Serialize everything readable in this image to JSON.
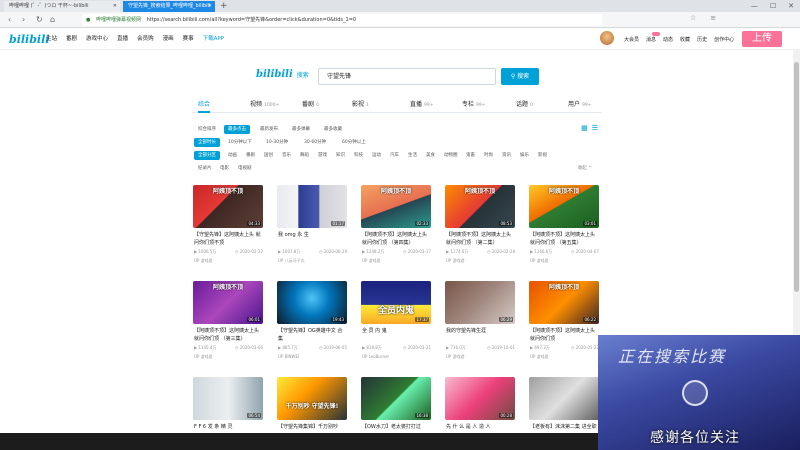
{
  "browser": {
    "tabs": [
      {
        "title": "哔哩哔哩 (゜-゜)つロ 干杯~-bilibili"
      },
      {
        "title": "守望先锋_搜索结果_哔哩哔哩_bilibili"
      }
    ],
    "new_tab": "+",
    "window_controls": [
      "—",
      "☐",
      "✕"
    ],
    "nav": {
      "back": "‹",
      "forward": "›",
      "reload": "↻",
      "home": "⌂"
    },
    "url_site": "哔哩哔哩弹幕视频网",
    "url": "https://search.bilibili.com/all?keyword=守望先锋&order=click&duration=0&tids_1=0"
  },
  "header": {
    "logo": "bilibili",
    "nav": [
      "主站",
      "番剧",
      "游戏中心",
      "直播",
      "会员购",
      "漫画",
      "赛事"
    ],
    "app": "下载APP",
    "right": [
      "大会员",
      "消息",
      "动态",
      "收藏",
      "历史",
      "创作中心"
    ],
    "upload": "上传"
  },
  "search": {
    "logo": "bilibili",
    "logo_sub": "搜索",
    "query": "守望先锋",
    "button": "搜索"
  },
  "category_tabs": [
    {
      "label": "综合",
      "count": ""
    },
    {
      "label": "视频",
      "count": "1000+"
    },
    {
      "label": "番剧",
      "count": "0"
    },
    {
      "label": "影视",
      "count": "1"
    },
    {
      "label": "直播",
      "count": "99+"
    },
    {
      "label": "专栏",
      "count": "99+"
    },
    {
      "label": "话题",
      "count": "0"
    },
    {
      "label": "用户",
      "count": "99+"
    }
  ],
  "filters": {
    "order": [
      "综合排序",
      "最多点击",
      "最新发布",
      "最多弹幕",
      "最多收藏"
    ],
    "duration": [
      "全部时长",
      "10分钟以下",
      "10-30分钟",
      "30-60分钟",
      "60分钟以上"
    ],
    "zones_1": [
      "全部分区",
      "动画",
      "番剧",
      "国创",
      "音乐",
      "舞蹈",
      "游戏",
      "知识",
      "科技",
      "运动",
      "汽车",
      "生活",
      "美食",
      "动物圈",
      "鬼畜",
      "时尚",
      "资讯",
      "娱乐",
      "影视"
    ],
    "zones_2": [
      "纪录片",
      "电影",
      "电视剧"
    ],
    "fold": "收起 ^"
  },
  "videos": [
    {
      "title": "【守望先锋】这阿姨太上头 就问你们顶不顶",
      "duration": "04:33",
      "plays": "1006.5万",
      "date": "2020-02-22",
      "uploader": "游戏君",
      "caption": "阿姨顶不顶"
    },
    {
      "title": "我 omg 永 生",
      "duration": "01:17",
      "plays": "1007.8万",
      "date": "2020-06-29",
      "uploader": "八云马子丸",
      "caption": ""
    },
    {
      "title": "【阿姨顶不顶】这阿姨太上头 就问你们顶 （第四集）",
      "duration": "02:33",
      "plays": "1248.2万",
      "date": "2020-03-17",
      "uploader": "游戏君",
      "caption": "阿姨顶不顶"
    },
    {
      "title": "【阿姨顶不顶】这阿姨太上头 就问你们顶 （第二集）",
      "duration": "08:53",
      "plays": "1174.6万",
      "date": "2020-02-28",
      "uploader": "游戏君",
      "caption": "阿姨顶不顶"
    },
    {
      "title": "【阿姨顶不顶】这阿姨太上头 就问你们顶 （第五集）",
      "duration": "03:01",
      "plays": "1166.6万",
      "date": "2020-04-07",
      "uploader": "游戏君",
      "caption": "阿姨顶不顶"
    },
    {
      "title": "【阿姨顶不顶】这阿姨太上头 就问你们顶 （第三集）",
      "duration": "06:01",
      "plays": "1145.4万",
      "date": "2020-03-06",
      "uploader": "游戏君",
      "caption": "阿姨顶不顶"
    },
    {
      "title": "【守望先锋】OG英雄中文 合集",
      "duration": "19:43",
      "plays": "885.7万",
      "date": "2019-06-05",
      "uploader": "BINWEI",
      "caption": ""
    },
    {
      "title": "全 员 内 鬼",
      "duration": "17:37",
      "plays": "819.8万",
      "date": "2020-03-21",
      "uploader": "LeoBurner",
      "caption": "全员内鬼"
    },
    {
      "title": "我的守望先锋生涯",
      "duration": "06:29",
      "plays": "736.0万",
      "date": "2019-10-01",
      "uploader": "游戏君",
      "caption": ""
    },
    {
      "title": "【阿姨顶不顶】这阿姨太上头 就问你们顶",
      "duration": "06:22",
      "plays": "697.3万",
      "date": "2020-05-22",
      "uploader": "游戏君",
      "caption": "阿姨顶不顶"
    },
    {
      "title": "F F 6 发 条 精 灵",
      "duration": "06:54",
      "plays": "",
      "date": "",
      "uploader": "",
      "caption": ""
    },
    {
      "title": "【守望先锋集锦】千万别吵",
      "duration": "",
      "plays": "",
      "date": "",
      "uploader": "",
      "caption": "千万别吵 守望先锋!"
    },
    {
      "title": "【OW水刀】老太婆打打过",
      "duration": "16:38",
      "plays": "",
      "date": "",
      "uploader": "",
      "caption": ""
    },
    {
      "title": "先 什 么 是 人 造 人",
      "duration": "00:28",
      "plays": "",
      "date": "",
      "uploader": "",
      "caption": ""
    },
    {
      "title": "【老板有】沫沫第二集 进全职",
      "duration": "",
      "plays": "",
      "date": "",
      "uploader": "",
      "caption": ""
    }
  ],
  "overlay": {
    "banner": "正在搜索比赛",
    "thanks": "感谢各位关注"
  },
  "icons": {
    "play": "▶",
    "date": "◷",
    "up": "UP",
    "grid_view": "▦",
    "list_view": "☰"
  },
  "colors": {
    "accent": "#00a1d6",
    "pink": "#fb7299"
  }
}
